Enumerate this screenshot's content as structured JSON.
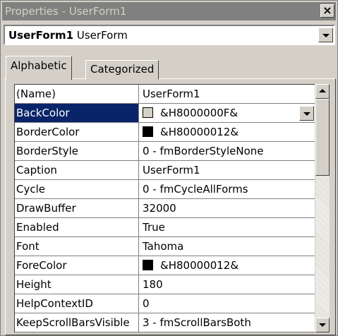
{
  "window": {
    "title": "Properties - UserForm1",
    "close_label": "×"
  },
  "object_selector": {
    "name": "UserForm1",
    "type": "UserForm"
  },
  "tabs": [
    {
      "label": "Alphabetic"
    },
    {
      "label": "Categorized"
    }
  ],
  "properties": [
    {
      "name": "(Name)",
      "value": "UserForm1"
    },
    {
      "name": "BackColor",
      "value": "&H8000000F&",
      "swatch": "#d4d0c8"
    },
    {
      "name": "BorderColor",
      "value": "&H80000012&",
      "swatch": "#000000"
    },
    {
      "name": "BorderStyle",
      "value": "0 - fmBorderStyleNone"
    },
    {
      "name": "Caption",
      "value": "UserForm1"
    },
    {
      "name": "Cycle",
      "value": "0 - fmCycleAllForms"
    },
    {
      "name": "DrawBuffer",
      "value": "32000"
    },
    {
      "name": "Enabled",
      "value": "True"
    },
    {
      "name": "Font",
      "value": "Tahoma"
    },
    {
      "name": "ForeColor",
      "value": "&H80000012&",
      "swatch": "#000000"
    },
    {
      "name": "Height",
      "value": "180"
    },
    {
      "name": "HelpContextID",
      "value": "0"
    },
    {
      "name": "KeepScrollBarsVisible",
      "value": "3 - fmScrollBarsBoth"
    }
  ],
  "selected_property": "BackColor",
  "colors": {
    "selection": "#0a246a",
    "face": "#d4d0c8",
    "title_inactive": "#808080"
  }
}
